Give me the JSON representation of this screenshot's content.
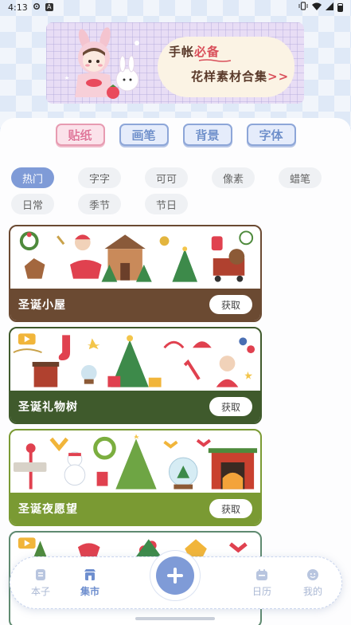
{
  "status_bar": {
    "time": "4:13",
    "notification_icon": "A"
  },
  "banner": {
    "line1_a": "手帐",
    "line1_b": "必备",
    "line2": "花样素材合集",
    "line2_chev": ">>"
  },
  "tabs": [
    {
      "label": "贴纸",
      "active": true
    },
    {
      "label": "画笔",
      "active": false
    },
    {
      "label": "背景",
      "active": false
    },
    {
      "label": "字体",
      "active": false
    }
  ],
  "tags": [
    {
      "label": "热门",
      "active": true
    },
    {
      "label": "字字"
    },
    {
      "label": "可可"
    },
    {
      "label": "像素"
    },
    {
      "label": "蜡笔"
    },
    {
      "label": "日常"
    },
    {
      "label": "季节"
    },
    {
      "label": "节日"
    }
  ],
  "cards": [
    {
      "title": "圣诞小屋",
      "button": "获取",
      "color": "#6b4a32"
    },
    {
      "title": "圣诞礼物树",
      "button": "获取",
      "color": "#3f5a2c"
    },
    {
      "title": "圣诞夜愿望",
      "button": "获取",
      "color": "#7a9a33"
    },
    {
      "title": "",
      "button": "",
      "color": "#5f8a70"
    }
  ],
  "bottom_nav": [
    {
      "label": "本子",
      "icon": "notebook-icon"
    },
    {
      "label": "集市",
      "icon": "store-icon",
      "active": true
    },
    {
      "label": "日历",
      "icon": "calendar-icon"
    },
    {
      "label": "我的",
      "icon": "profile-icon"
    }
  ],
  "colors": {
    "accent": "#7f9bd7",
    "pink": "#e0779a"
  }
}
